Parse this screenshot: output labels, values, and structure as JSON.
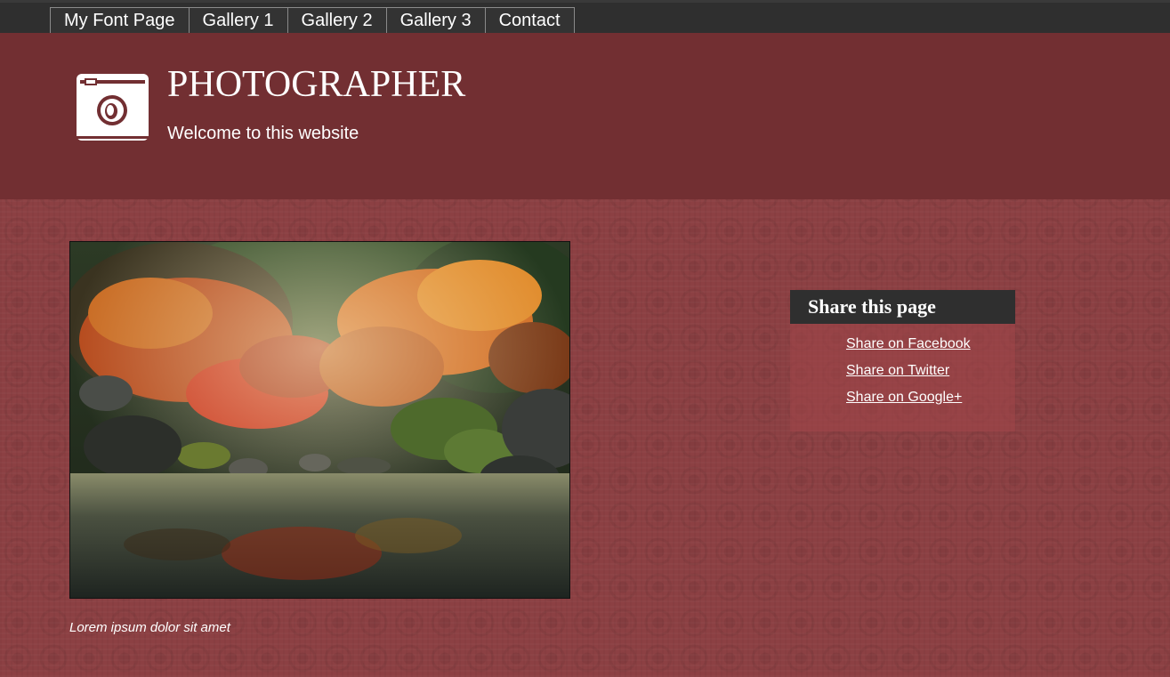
{
  "nav": {
    "items": [
      {
        "label": "My Font Page"
      },
      {
        "label": "Gallery 1"
      },
      {
        "label": "Gallery 2"
      },
      {
        "label": "Gallery 3"
      },
      {
        "label": "Contact"
      }
    ]
  },
  "header": {
    "title": "PHOTOGRAPHER",
    "tagline": "Welcome to this website",
    "logo_icon": "camera-icon"
  },
  "main": {
    "caption": "Lorem ipsum dolor sit amet"
  },
  "sidebar": {
    "share_title": "Share this page",
    "links": [
      {
        "label": "Share on Facebook"
      },
      {
        "label": "Share on Twitter"
      },
      {
        "label": "Share on Google+"
      }
    ]
  },
  "colors": {
    "nav_bg": "#2f2f2f",
    "header_bg": "#722f32",
    "body_bg": "#8c4043",
    "text": "#ffffff"
  }
}
